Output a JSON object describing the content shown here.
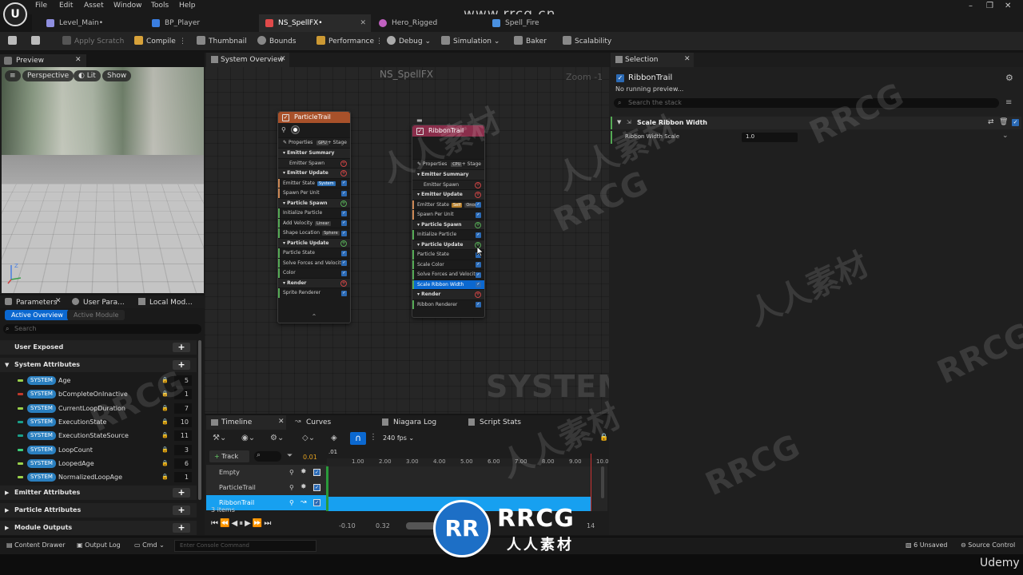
{
  "menu": [
    "File",
    "Edit",
    "Asset",
    "Window",
    "Tools",
    "Help"
  ],
  "doc_tabs": [
    {
      "label": "Level_Main•",
      "color": "#8f8fe0"
    },
    {
      "label": "BP_Player",
      "color": "#3a7ee0"
    },
    {
      "label": "NS_SpellFX•",
      "color": "#e04a4a"
    },
    {
      "label": "Hero_Rigged",
      "color": "#c060c0"
    },
    {
      "label": "Spell_Fire",
      "color": "#4a90e0"
    }
  ],
  "toolbar": {
    "apply_scratch": "Apply Scratch",
    "compile": "Compile",
    "thumbnail": "Thumbnail",
    "bounds": "Bounds",
    "performance": "Performance",
    "debug": "Debug",
    "simulation": "Simulation",
    "baker": "Baker",
    "scalability": "Scalability"
  },
  "preview": {
    "tab": "Preview",
    "perspective": "Perspective",
    "lit": "Lit",
    "show": "Show"
  },
  "params": {
    "tabs": [
      "Parameters",
      "User Para...",
      "Local Mod..."
    ],
    "active_overview": "Active Overview",
    "active_module": "Active Module",
    "search_placeholder": "Search",
    "user_exposed": "User Exposed",
    "system_attributes": "System Attributes",
    "system_tag": "SYSTEM",
    "attributes": [
      {
        "name": "Age",
        "value": "5",
        "color": "#9ad14b"
      },
      {
        "name": "bCompleteOnInactive",
        "value": "1",
        "color": "#c0392b"
      },
      {
        "name": "CurrentLoopDuration",
        "value": "7",
        "color": "#9ad14b"
      },
      {
        "name": "ExecutionState",
        "value": "10",
        "color": "#1aa08a"
      },
      {
        "name": "ExecutionStateSource",
        "value": "11",
        "color": "#1aa08a"
      },
      {
        "name": "LoopCount",
        "value": "3",
        "color": "#3dcf7a"
      },
      {
        "name": "LoopedAge",
        "value": "6",
        "color": "#9ad14b"
      },
      {
        "name": "NormalizedLoopAge",
        "value": "1",
        "color": "#9ad14b"
      }
    ],
    "emitter_attributes": "Emitter Attributes",
    "particle_attributes": "Particle Attributes",
    "module_outputs": "Module Outputs"
  },
  "graph": {
    "tab": "System Overview",
    "title": "NS_SpellFX",
    "zoom": "Zoom -1",
    "watermark": "SYSTEM",
    "particle_trail": {
      "title": "ParticleTrail",
      "properties": "Properties",
      "stage": "+ Stage",
      "rows": [
        {
          "label": "Emitter Summary",
          "kind": "hdr"
        },
        {
          "label": "Emitter Spawn",
          "kind": "plain",
          "add": "r"
        },
        {
          "label": "Emitter Update",
          "kind": "hdr",
          "add": "r"
        },
        {
          "label": "Emitter State",
          "tag": "System",
          "tagc": "blue",
          "cb": true
        },
        {
          "label": "Spawn Per Unit",
          "cb": true
        },
        {
          "label": "Particle Spawn",
          "kind": "hdr",
          "add": "g"
        },
        {
          "label": "Initialize Particle",
          "cb": true
        },
        {
          "label": "Add Velocity",
          "tag": "Linear",
          "cb": true
        },
        {
          "label": "Shape Location",
          "tag": "Sphere",
          "cb": true
        },
        {
          "label": "Particle Update",
          "kind": "hdr",
          "add": "g"
        },
        {
          "label": "Particle State",
          "cb": true
        },
        {
          "label": "Solve Forces and Velocity",
          "cb": true
        },
        {
          "label": "Color",
          "cb": true
        },
        {
          "label": "Render",
          "kind": "hdr",
          "add": "r"
        },
        {
          "label": "Sprite Renderer",
          "cb": true
        }
      ]
    },
    "ribbon_trail": {
      "title": "RibbonTrail",
      "properties": "Properties",
      "stage": "+ Stage",
      "rows": [
        {
          "label": "Emitter Summary",
          "kind": "hdr"
        },
        {
          "label": "Emitter Spawn",
          "kind": "plain",
          "add": "r"
        },
        {
          "label": "Emitter Update",
          "kind": "hdr",
          "add": "r"
        },
        {
          "label": "Emitter State",
          "tag": "Self",
          "tagc": "orange",
          "tag2": "Once",
          "cb": true
        },
        {
          "label": "Spawn Per Unit",
          "cb": true
        },
        {
          "label": "Particle Spawn",
          "kind": "hdr",
          "add": "g"
        },
        {
          "label": "Initialize Particle",
          "cb": true
        },
        {
          "label": "Particle Update",
          "kind": "hdr",
          "add": "g"
        },
        {
          "label": "Particle State",
          "cb": true
        },
        {
          "label": "Scale Color",
          "cb": true
        },
        {
          "label": "Solve Forces and Velocity",
          "cb": true
        },
        {
          "label": "Scale Ribbon Width",
          "cb": true,
          "sel": true
        },
        {
          "label": "Render",
          "kind": "hdr",
          "add": "r"
        },
        {
          "label": "Ribbon Renderer",
          "cb": true
        }
      ]
    }
  },
  "selection": {
    "tab": "Selection",
    "title": "RibbonTrail",
    "status": "No running preview...",
    "search_placeholder": "Search the stack",
    "module": "Scale Ribbon Width",
    "param_label": "Ribbon Width Scale",
    "param_value": "1.0"
  },
  "timeline": {
    "tabs": [
      "Timeline",
      "Curves",
      "Niagara Log",
      "Script Stats"
    ],
    "fps": "240 fps",
    "add_track": "Track",
    "current_time": "0.01",
    "playhead_label": ".01",
    "ruler": [
      "1.00",
      "2.00",
      "3.00",
      "4.00",
      "5.00",
      "6.00",
      "7.00",
      "8.00",
      "9.00",
      "10.0"
    ],
    "tracks": [
      "Empty",
      "ParticleTrail",
      "RibbonTrail"
    ],
    "item_count": "3 items",
    "range_start": "-0.10",
    "range_cur": "0.32",
    "range_end": "14"
  },
  "statusbar": {
    "content_drawer": "Content Drawer",
    "output_log": "Output Log",
    "cmd": "Cmd",
    "console_placeholder": "Enter Console Command",
    "unsaved": "6 Unsaved",
    "source_control": "Source Control"
  },
  "overlay": {
    "site": "www.rrcg.cn",
    "brand": "RRCG",
    "brand_sub": "人人素材",
    "brand_icon": "RR",
    "udemy": "Udemy",
    "wm_a": "人人素材",
    "wm_b": "RRCG"
  }
}
